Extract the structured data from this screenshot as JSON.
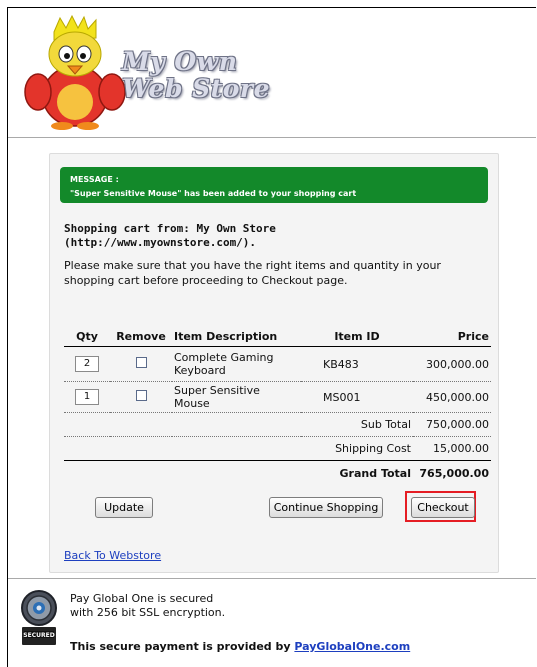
{
  "store": {
    "name_line1": "My Own",
    "name_line2": "Web Store"
  },
  "message": {
    "title": "MESSAGE :",
    "text": "\"Super Sensitive Mouse\" has been added to your shopping cart"
  },
  "cart": {
    "heading_line1": "Shopping cart from: My Own Store",
    "heading_line2": "(http://www.myownstore.com/).",
    "note": "Please make sure that you have the right items and quantity in your shopping cart before proceeding to Checkout page.",
    "columns": [
      "Qty",
      "Remove",
      "Item Description",
      "Item ID",
      "Price"
    ],
    "items": [
      {
        "qty": "2",
        "description": "Complete Gaming Keyboard",
        "item_id": "KB483",
        "price": "300,000.00"
      },
      {
        "qty": "1",
        "description": "Super Sensitive Mouse",
        "item_id": "MS001",
        "price": "450,000.00"
      }
    ],
    "subtotal_label": "Sub Total",
    "subtotal": "750,000.00",
    "shipping_label": "Shipping Cost",
    "shipping": "15,000.00",
    "grand_total_label": "Grand Total",
    "grand_total": "765,000.00"
  },
  "buttons": {
    "update": "Update",
    "continue": "Continue Shopping",
    "checkout": "Checkout"
  },
  "links": {
    "back": "Back To Webstore"
  },
  "footer": {
    "secure_line1": "Pay Global One is secured",
    "secure_line2": "with 256 bit SSL encryption.",
    "provided_prefix": "This secure payment is provided by ",
    "provided_link": "PayGlobalOne.com"
  },
  "colors": {
    "message_bg": "#13892a",
    "checkout_highlight": "#e51d24",
    "link": "#1d3fbf"
  }
}
